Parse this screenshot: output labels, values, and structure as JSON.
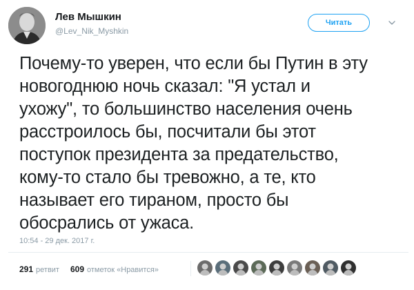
{
  "user": {
    "display_name": "Лев Мышкин",
    "username": "@Lev_Nik_Myshkin"
  },
  "actions": {
    "follow_label": "Читать"
  },
  "tweet": {
    "text": "Почему-то уверен, что если бы Путин в эту\nновогоднюю ночь сказал: \"Я устал и\nухожу\", то большинство населения очень\nрасстроилось бы, посчитали бы этот\nпоступок президента за предательство,\nкому-то стало бы тревожно, а те, кто\nназывает его тираном, просто бы\nобосрались от ужаса.",
    "timestamp": "10:54 - 29 дек. 2017 г."
  },
  "stats": {
    "retweets_count": "291",
    "retweets_label": "ретвит",
    "likes_count": "609",
    "likes_label": "отметок «Нравится»"
  },
  "likers": [
    {
      "icon": "avatar-1",
      "color": "#6b6b6b"
    },
    {
      "icon": "avatar-2",
      "color": "#5a6e7a"
    },
    {
      "icon": "avatar-3",
      "color": "#4a4a4a"
    },
    {
      "icon": "avatar-4",
      "color": "#5c6a58"
    },
    {
      "icon": "avatar-5",
      "color": "#3d3d3d"
    },
    {
      "icon": "avatar-6",
      "color": "#7a7a7a"
    },
    {
      "icon": "avatar-7",
      "color": "#6a5f55"
    },
    {
      "icon": "avatar-8",
      "color": "#4f5a62"
    },
    {
      "icon": "avatar-9",
      "color": "#2f2f2f"
    }
  ],
  "colors": {
    "accent": "#1da1f2",
    "muted": "#8a9aa5",
    "text": "#1c2022"
  }
}
